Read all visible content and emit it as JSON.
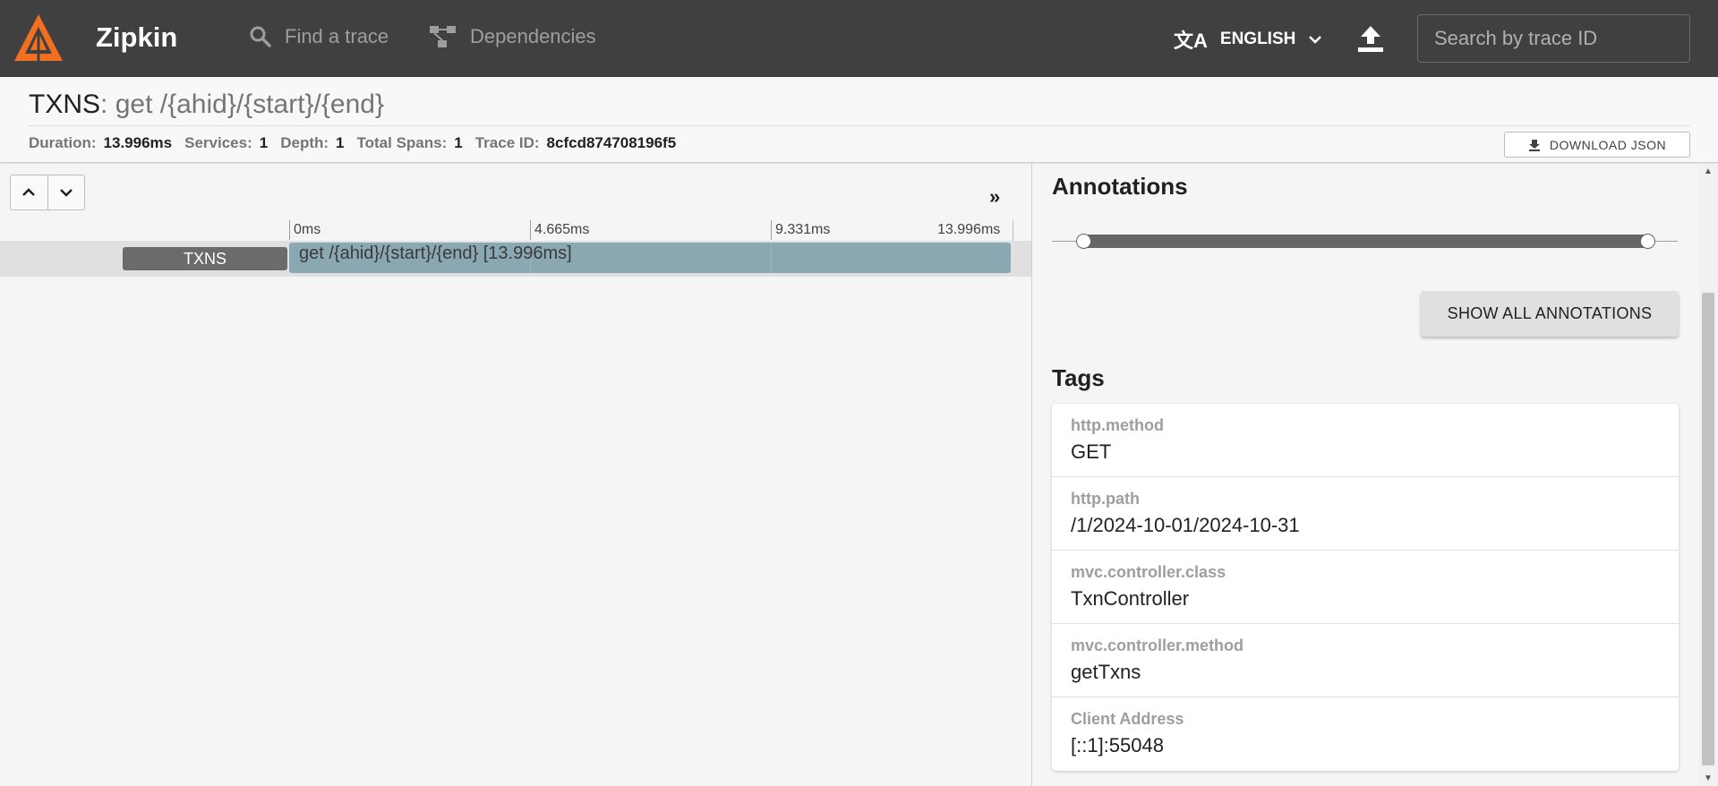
{
  "app": {
    "brand": "Zipkin",
    "accent": "#f26f21"
  },
  "nav": {
    "find_trace": "Find a trace",
    "dependencies": "Dependencies"
  },
  "lang": {
    "label": "ENGLISH",
    "icon": "translate-icon"
  },
  "search": {
    "placeholder": "Search by trace ID"
  },
  "trace": {
    "service": "TXNS",
    "separator": ":",
    "span_name": "get /{ahid}/{start}/{end}",
    "meta": {
      "duration_label": "Duration:",
      "duration": "13.996ms",
      "services_label": "Services:",
      "services": "1",
      "depth_label": "Depth:",
      "depth": "1",
      "spans_label": "Total Spans:",
      "spans": "1",
      "traceid_label": "Trace ID:",
      "trace_id": "8cfcd874708196f5"
    },
    "download": "DOWNLOAD JSON"
  },
  "timeline": {
    "ticks": [
      "0ms",
      "4.665ms",
      "9.331ms",
      "13.996ms"
    ],
    "rows": [
      {
        "service": "TXNS",
        "label": "get /{ahid}/{start}/{end} [13.996ms]",
        "start_fraction": 0,
        "duration_fraction": 1
      }
    ],
    "expand": "»"
  },
  "annotations": {
    "title": "Annotations",
    "show_all": "SHOW ALL ANNOTATIONS",
    "range": [
      0,
      1
    ]
  },
  "tags": {
    "title": "Tags",
    "items": [
      {
        "key": "http.method",
        "value": "GET"
      },
      {
        "key": "http.path",
        "value": "/1/2024-10-01/2024-10-31"
      },
      {
        "key": "mvc.controller.class",
        "value": "TxnController"
      },
      {
        "key": "mvc.controller.method",
        "value": "getTxns"
      },
      {
        "key": "Client Address",
        "value": "[::1]:55048"
      }
    ]
  }
}
